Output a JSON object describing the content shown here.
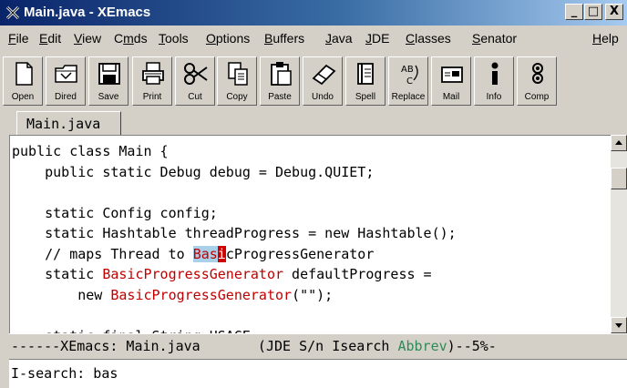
{
  "window": {
    "title": "Main.java - XEmacs",
    "minimize_glyph": "_",
    "maximize_glyph": "□",
    "close_glyph": "X"
  },
  "menu": [
    {
      "key": "F",
      "rest": "ile"
    },
    {
      "key": "E",
      "rest": "dit"
    },
    {
      "key": "V",
      "rest": "iew"
    },
    {
      "pre": "C",
      "key": "m",
      "rest": "ds"
    },
    {
      "key": "T",
      "rest": "ools"
    },
    {
      "key": "O",
      "rest": "ptions"
    },
    {
      "key": "B",
      "rest": "uffers"
    },
    {
      "key": "J",
      "rest": "ava"
    },
    {
      "key": "J",
      "rest": "DE"
    },
    {
      "key": "C",
      "rest": "lasses"
    },
    {
      "key": "S",
      "rest": "enator"
    },
    {
      "key": "H",
      "rest": "elp"
    }
  ],
  "toolbar": [
    {
      "label": "Open",
      "icon": "open-file-icon"
    },
    {
      "label": "Dired",
      "icon": "folder-icon"
    },
    {
      "label": "Save",
      "icon": "floppy-icon"
    },
    {
      "label": "Print",
      "icon": "printer-icon"
    },
    {
      "label": "Cut",
      "icon": "scissors-icon"
    },
    {
      "label": "Copy",
      "icon": "copy-icon"
    },
    {
      "label": "Paste",
      "icon": "clipboard-icon"
    },
    {
      "label": "Undo",
      "icon": "eraser-icon"
    },
    {
      "label": "Spell",
      "icon": "spellbook-icon"
    },
    {
      "label": "Replace",
      "icon": "replace-icon"
    },
    {
      "label": "Mail",
      "icon": "mail-icon"
    },
    {
      "label": "Info",
      "icon": "info-icon"
    },
    {
      "label": "Comp",
      "icon": "compile-icon"
    }
  ],
  "tab": {
    "label": "Main.java"
  },
  "code": {
    "line1": "public class Main {",
    "line2": "    public static Debug debug = Debug.QUIET;",
    "line3": "",
    "line4": "    static Config config;",
    "line5": "    static Hashtable threadProgress = new Hashtable();",
    "line6_pre": "    // maps Thread to ",
    "line6_hl": "Bas",
    "line6_cursor": "i",
    "line6_post": "cProgressGenerator",
    "line7_pre": "    static ",
    "line7_fn": "BasicProgressGenerator",
    "line7_post": " defaultProgress =",
    "line8_pre": "        new ",
    "line8_fn": "BasicProgressGenerator",
    "line8_post": "(\"\");",
    "line9": "",
    "line10": "    static final String USAGE ="
  },
  "modeline": {
    "left": "------XEmacs: Main.java       (JDE S/n Isearch ",
    "abbrev": "Abbrev",
    "right": ")--5%-"
  },
  "minibuffer": {
    "text": "I-search: bas"
  },
  "colors": {
    "titlebar_start": "#0a246a",
    "titlebar_end": "#a6caf0",
    "face": "#d4d0c8",
    "search_highlight": "#a8d0e8",
    "match_text": "#c00000",
    "abbrev_green": "#2e8b57"
  }
}
